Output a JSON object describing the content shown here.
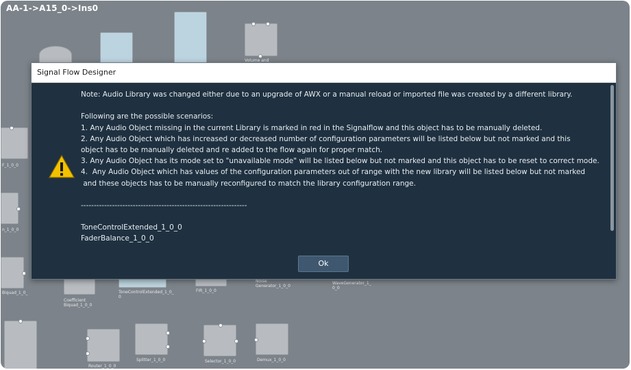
{
  "canvas": {
    "path_title": "AA-1->A15_0->Ins0",
    "block_labels": [
      "Volume and",
      "F_1_0_0",
      "n_1_0_0",
      "Biquad_1_0_",
      "Coefficient\nBiquad_1_0_0",
      "ToneControlExtended_1_0_\n0",
      "FIR_1_0_0",
      "Noise\nGenerator_1_0_0",
      "WaveGenerator_1_\n0_0",
      "Router_1_0_0",
      "Splitter_1_0_0",
      "Selector_1_0_0",
      "Demux_1_0_0"
    ]
  },
  "dialog": {
    "title": "Signal Flow Designer",
    "icon": "warning-triangle-icon",
    "message_lines": [
      "Note: Audio Library was changed either due to an upgrade of AWX or a manual reload or imported file was created by a different library.",
      "",
      "Following are the possible scenarios:",
      "1. Any Audio Object missing in the current Library is marked in red in the Signalflow and this object has to be manually deleted.",
      "2. Any Audio Object which has increased or decreased number of configuration parameters will be listed below but not marked and this",
      "object has to be manually deleted and re added to the flow again for proper match.",
      "3. Any Audio Object has its mode set to \"unavailable mode\" will be listed below but not marked and this object has to be reset to correct mode.",
      "4.  Any Audio Object which has values of the configuration parameters out of range with the new library will be listed below but not marked",
      " and these objects has to be manually reconfigured to match the library configuration range.",
      "",
      "----------------------------------------------------------------",
      "",
      "ToneControlExtended_1_0_0",
      "FaderBalance_1_0_0",
      "----------------------------------------------------------------"
    ],
    "ok_label": "Ok"
  },
  "colors": {
    "canvas_bg": "#7c838a",
    "dialog_bg": "#1f3140",
    "button_bg": "#3f5870",
    "warning_yellow": "#f2c200"
  }
}
